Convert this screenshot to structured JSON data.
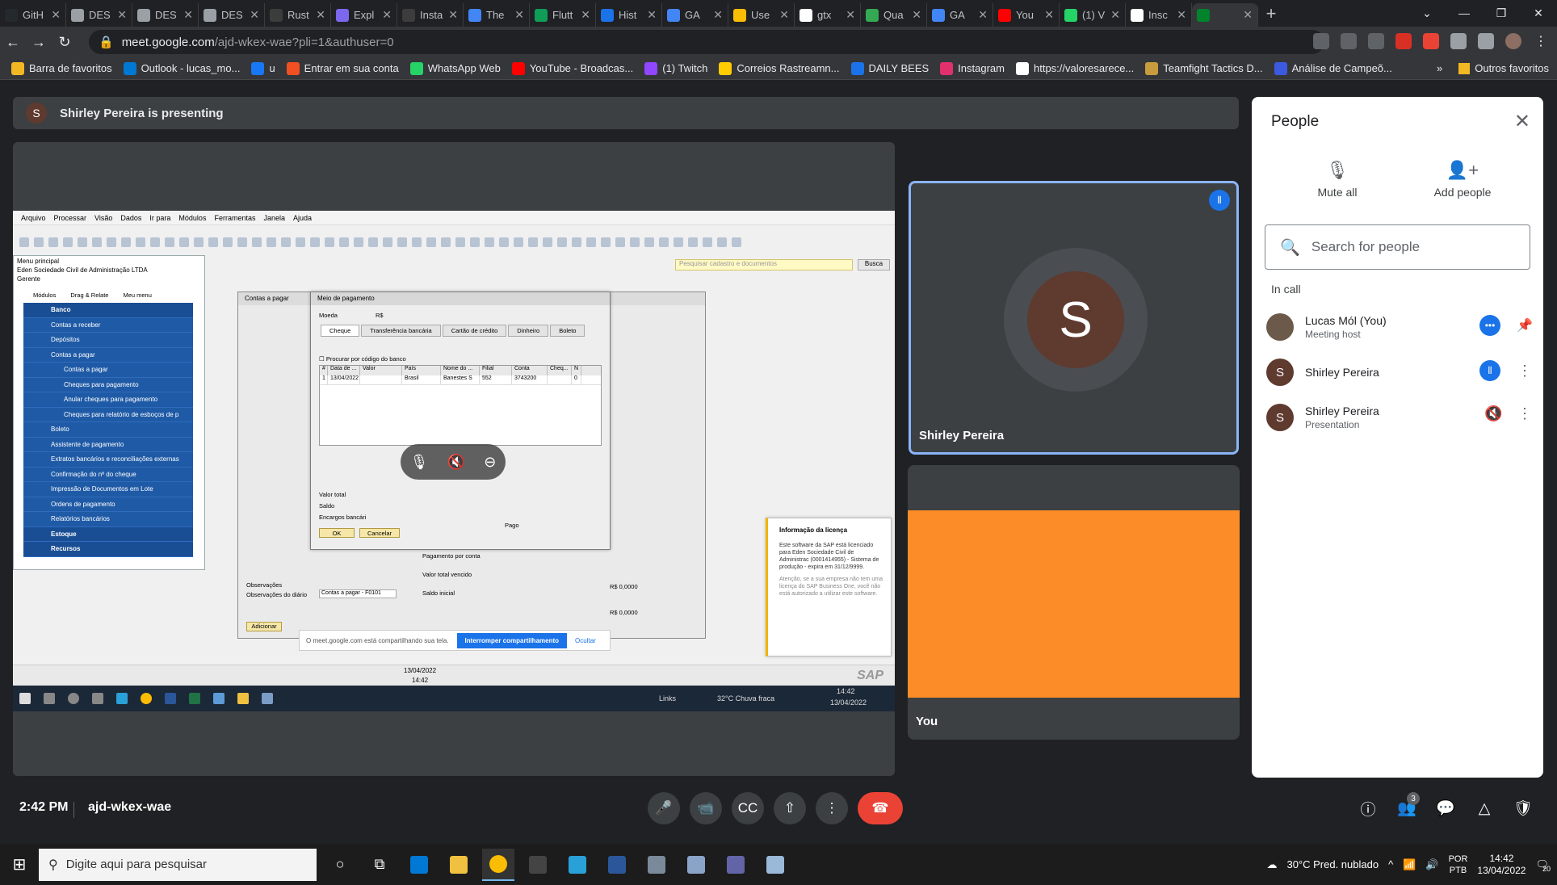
{
  "browser": {
    "tabs": [
      {
        "label": "GitH",
        "color": "#24292e"
      },
      {
        "label": "DES",
        "color": "#9aa0a6"
      },
      {
        "label": "DES",
        "color": "#9aa0a6"
      },
      {
        "label": "DES",
        "color": "#9aa0a6"
      },
      {
        "label": "Rust",
        "color": "#3c3c3c"
      },
      {
        "label": "Expl",
        "color": "#7b68ee"
      },
      {
        "label": "Insta",
        "color": "#3c3c3c"
      },
      {
        "label": "The",
        "color": "#4285f4"
      },
      {
        "label": "Flutt",
        "color": "#0f9d58"
      },
      {
        "label": "Hist",
        "color": "#1a73e8"
      },
      {
        "label": "GA",
        "color": "#4285f4"
      },
      {
        "label": "Use",
        "color": "#fbbc04"
      },
      {
        "label": "gtx",
        "color": "#ffffff"
      },
      {
        "label": "Qua",
        "color": "#34a853"
      },
      {
        "label": "GA",
        "color": "#4285f4"
      },
      {
        "label": "You",
        "color": "#ff0000"
      },
      {
        "label": "(1) V",
        "color": "#25d366"
      },
      {
        "label": "Insc",
        "color": "#ffffff"
      },
      {
        "label": "",
        "color": "#00832d",
        "active": true
      }
    ],
    "url_host": "meet.google.com",
    "url_path": "/ajd-wkex-wae?pli=1&authuser=0",
    "bookmarks": [
      {
        "label": "Barra de favoritos",
        "color": "#f2b824"
      },
      {
        "label": "Outlook - lucas_mo...",
        "color": "#0078d4"
      },
      {
        "label": "u",
        "color": "#1877f2"
      },
      {
        "label": "Entrar em sua conta",
        "color": "#f25022"
      },
      {
        "label": "WhatsApp Web",
        "color": "#25d366"
      },
      {
        "label": "YouTube - Broadcas...",
        "color": "#ff0000"
      },
      {
        "label": "(1) Twitch",
        "color": "#9146ff"
      },
      {
        "label": "Correios Rastreamn...",
        "color": "#ffcc00"
      },
      {
        "label": "DAILY BEES",
        "color": "#1a73e8"
      },
      {
        "label": "Instagram",
        "color": "#e1306c"
      },
      {
        "label": "https://valoresarece...",
        "color": "#ffffff"
      },
      {
        "label": "Teamfight Tactics D...",
        "color": "#c89b3c"
      },
      {
        "label": "Análise de Campeõ...",
        "color": "#3c5ae0"
      }
    ],
    "other_favorites": "Outros favoritos"
  },
  "meet": {
    "presenting_initial": "S",
    "presenting_text": "Shirley Pereira is presenting",
    "tile_main_initial": "S",
    "tile_main_name": "Shirley Pereira",
    "tile_you_name": "You",
    "clock": "2:42 PM",
    "meeting_code": "ajd-wkex-wae",
    "participants_count": "3"
  },
  "people_panel": {
    "title": "People",
    "mute_all": "Mute all",
    "add_people": "Add people",
    "search_placeholder": "Search for people",
    "in_call": "In call",
    "participants": [
      {
        "initial": "",
        "name": "Lucas Mól (You)",
        "sub": "Meeting host"
      },
      {
        "initial": "S",
        "name": "Shirley Pereira",
        "sub": ""
      },
      {
        "initial": "S",
        "name": "Shirley Pereira",
        "sub": "Presentation"
      }
    ]
  },
  "shared_screen": {
    "menu": [
      "Arquivo",
      "Processar",
      "Visão",
      "Dados",
      "Ir para",
      "Módulos",
      "Ferramentas",
      "Janela",
      "Ajuda"
    ],
    "search_placeholder": "Pesquisar cadastro e documentos",
    "search_button": "Busca",
    "menu_panel_title": "Menu principal",
    "company": "Eden Sociedade Civil de Administração LTDA",
    "role": "Gerente",
    "menu_tabs": [
      "Módulos",
      "Drag & Relate",
      "Meu menu"
    ],
    "menu_items": [
      {
        "label": "Banco",
        "level": "top"
      },
      {
        "label": "Contas a receber",
        "level": "lvl1"
      },
      {
        "label": "Depósitos",
        "level": "lvl1"
      },
      {
        "label": "Contas a pagar",
        "level": "lvl1"
      },
      {
        "label": "Contas a pagar",
        "level": "lvl2"
      },
      {
        "label": "Cheques para pagamento",
        "level": "lvl2"
      },
      {
        "label": "Anular cheques para pagamento",
        "level": "lvl2"
      },
      {
        "label": "Cheques para relatório de esboços de p",
        "level": "lvl2"
      },
      {
        "label": "Boleto",
        "level": "lvl1"
      },
      {
        "label": "Assistente de pagamento",
        "level": "lvl1"
      },
      {
        "label": "Extratos bancários e reconciliações externas",
        "level": "lvl1"
      },
      {
        "label": "Confirmação do nº do cheque",
        "level": "lvl1"
      },
      {
        "label": "Impressão de Documentos em Lote",
        "level": "lvl1"
      },
      {
        "label": "Ordens de pagamento",
        "level": "lvl1"
      },
      {
        "label": "Relatórios bancários",
        "level": "lvl1"
      },
      {
        "label": "Estoque",
        "level": "top"
      },
      {
        "label": "Recursos",
        "level": "top"
      }
    ],
    "contas_title": "Contas a pagar",
    "dialog_title": "Meio de pagamento",
    "moeda_label": "Moeda",
    "moeda_value": "R$",
    "dialog_tabs": [
      "Cheque",
      "Transferência bancária",
      "Cartão de crédito",
      "Dinheiro",
      "Boleto"
    ],
    "checkbox_label": "Procurar por código do banco",
    "grid_headers": [
      "#",
      "Data de ...",
      "Valor",
      "País",
      "Nome do ...",
      "Filial",
      "Conta",
      "Cheq...",
      "N"
    ],
    "grid_row": [
      "1",
      "13/04/2022",
      "",
      "Brasil",
      "Banestes S",
      "552",
      "3743200",
      "",
      "0"
    ],
    "valor_total": "Valor total",
    "saldo": "Saldo",
    "encargos": "Encargos bancári",
    "pago": "Pago",
    "ok": "OK",
    "cancelar": "Cancelar",
    "observacoes": "Observações",
    "obs_diario": "Observações do diário",
    "obs_diario_value": "Contas a pagar - F0101",
    "valor_total_vencido": "Valor total vencido",
    "saldo_inicial": "Saldo inicial",
    "pagamento_conta": "Pagamento por conta",
    "adicionar": "Adicionar",
    "valor_zero_1": "R$ 0,0000",
    "valor_zero_2": "R$ 0,0000",
    "license_title": "Informação da licença",
    "license_body": "Este software da SAP está licenciado para Eden Sociedade Civil de Administrac (0001414955) - Sistema de produção - expira em 31/12/9999.",
    "license_warning": "Atenção, se a sua empresa não tem uma licença do SAP Business One, você não está autorizado a utilizar este software.",
    "share_notice": "O meet.google.com está compartilhando sua tela.",
    "stop_share": "Interromper compartilhamento",
    "hide": "Ocultar",
    "status_date": "13/04/2022",
    "status_time": "14:42",
    "sap_logo": "SAP",
    "inner_weather": "32°C Chuva fraca",
    "inner_links": "Links",
    "inner_time": "14:42",
    "inner_date": "13/04/2022"
  },
  "taskbar": {
    "search_placeholder": "Digite aqui para pesquisar",
    "weather": "30°C Pred. nublado",
    "lang_1": "POR",
    "lang_2": "PTB",
    "time": "14:42",
    "date": "13/04/2022",
    "notif_count": "20"
  }
}
